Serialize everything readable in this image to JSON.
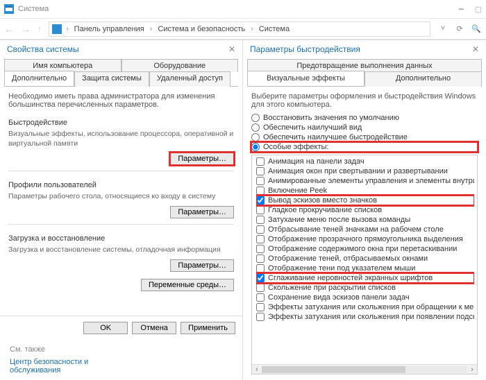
{
  "window": {
    "title": "Система",
    "breadcrumb": [
      "Панель управления",
      "Система и безопасность",
      "Система"
    ]
  },
  "left": {
    "pane_title": "Свойства системы",
    "tabs_row1": [
      "Имя компьютера",
      "Оборудование"
    ],
    "tabs_row2": [
      "Дополнительно",
      "Защита системы",
      "Удаленный доступ"
    ],
    "active_tab": "Дополнительно",
    "intro": "Необходимо иметь права администратора для изменения большинства перечисленных параметров.",
    "perf": {
      "title": "Быстродействие",
      "desc": "Визуальные эффекты, использование процессора, оперативной и виртуальной памяти",
      "button": "Параметры…"
    },
    "profiles": {
      "title": "Профили пользователей",
      "desc": "Параметры рабочего стола, относящиеся ко входу в систему",
      "button": "Параметры…"
    },
    "startup": {
      "title": "Загрузка и восстановление",
      "desc": "Загрузка и восстановление системы, отладочная информация",
      "button": "Параметры…"
    },
    "envvars_button": "Переменные среды…",
    "ok": "OK",
    "cancel": "Отмена",
    "apply": "Применить",
    "see_also_title": "См. также",
    "see_also_link": "Центр безопасности и обслуживания"
  },
  "right": {
    "pane_title": "Параметры быстродействия",
    "tabs_row1": [
      "Предотвращение выполнения данных"
    ],
    "tabs_row2": [
      "Визуальные эффекты",
      "Дополнительно"
    ],
    "active_tab": "Визуальные эффекты",
    "intro": "Выберите параметры оформления и быстродействия Windows для этого компьютера.",
    "radios": [
      {
        "label": "Восстановить значения по умолчанию",
        "checked": false
      },
      {
        "label": "Обеспечить наилучший вид",
        "checked": false
      },
      {
        "label": "Обеспечить наилучшее быстродействие",
        "checked": false
      },
      {
        "label": "Особые эффекты:",
        "checked": true,
        "highlight": true
      }
    ],
    "checks": [
      {
        "label": "Анимация на панели задач",
        "checked": false
      },
      {
        "label": "Анимация окон при свертывании и развертывании",
        "checked": false
      },
      {
        "label": "Анимированные элементы управления и элементы внутри окна",
        "checked": false
      },
      {
        "label": "Включение Peek",
        "checked": false
      },
      {
        "label": "Вывод эскизов вместо значков",
        "checked": true,
        "highlight": true
      },
      {
        "label": "Гладкое прокручивание списков",
        "checked": false
      },
      {
        "label": "Затухание меню после вызова команды",
        "checked": false
      },
      {
        "label": "Отбрасывание теней значками на рабочем столе",
        "checked": false
      },
      {
        "label": "Отображение прозрачного прямоугольника выделения",
        "checked": false
      },
      {
        "label": "Отображение содержимого окна при перетаскивании",
        "checked": false
      },
      {
        "label": "Отображение теней, отбрасываемых окнами",
        "checked": false
      },
      {
        "label": "Отображение тени под указателем мыши",
        "checked": false
      },
      {
        "label": "Сглаживание неровностей экранных шрифтов",
        "checked": true,
        "highlight": true
      },
      {
        "label": "Скольжение при раскрытии списков",
        "checked": false
      },
      {
        "label": "Сохранение вида эскизов панели задач",
        "checked": false
      },
      {
        "label": "Эффекты затухания или скольжения при обращении к меню",
        "checked": false
      },
      {
        "label": "Эффекты затухания или скольжения при появлении подсказок",
        "checked": false
      }
    ]
  }
}
